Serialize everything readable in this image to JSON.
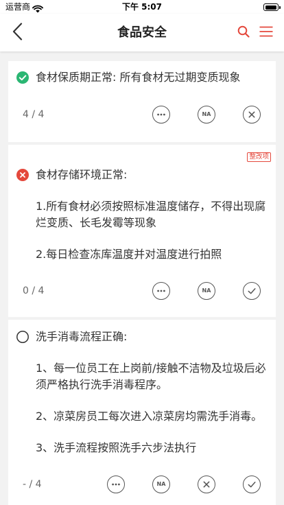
{
  "status_bar": {
    "carrier": "运营商",
    "time": "下午 5:07",
    "battery_level": 0.95,
    "wifi_icon": "wifi-icon",
    "battery_icon": "battery-icon"
  },
  "nav": {
    "title": "食品安全",
    "back_icon": "chevron-left-icon",
    "search_icon": "search-icon",
    "menu_icon": "menu-icon"
  },
  "colors": {
    "background": "#f2f2f2",
    "card": "#ffffff",
    "text": "#333333",
    "muted_text": "#666666",
    "accent_red": "#e4483c",
    "pass_green": "#2bb673",
    "fail_red": "#e4483c",
    "action_stroke": "#555555"
  },
  "items": [
    {
      "status_icon": "check-circle-icon",
      "title": "食材保质期正常: 所有食材无过期变质现象",
      "paragraphs": [],
      "score": "4 / 4",
      "actions": [
        {
          "icon": "more-icon"
        },
        {
          "icon": "na-icon",
          "label": "NA"
        },
        {
          "icon": "close-icon"
        }
      ]
    },
    {
      "status_icon": "error-circle-icon",
      "tag": "整改项",
      "title": "食材存储环境正常:",
      "paragraphs": [
        "1.所有食材必须按照标准温度储存，不得出现腐烂变质、长毛发霉等现象",
        "2.每日检查冻库温度并对温度进行拍照"
      ],
      "score": "0 / 4",
      "actions": [
        {
          "icon": "more-icon"
        },
        {
          "icon": "na-icon",
          "label": "NA"
        },
        {
          "icon": "check-icon"
        }
      ]
    },
    {
      "status_icon": "empty-circle-icon",
      "title": "洗手消毒流程正确:",
      "paragraphs": [
        "1、每一位员工在上岗前/接触不洁物及垃圾后必须严格执行洗手消毒程序。",
        "2、凉菜房员工每次进入凉菜房均需洗手消毒。",
        "3、洗手流程按照洗手六步法执行"
      ],
      "score": "- / 4",
      "actions": [
        {
          "icon": "more-icon"
        },
        {
          "icon": "na-icon",
          "label": "NA"
        },
        {
          "icon": "close-icon"
        },
        {
          "icon": "check-icon"
        }
      ]
    }
  ]
}
